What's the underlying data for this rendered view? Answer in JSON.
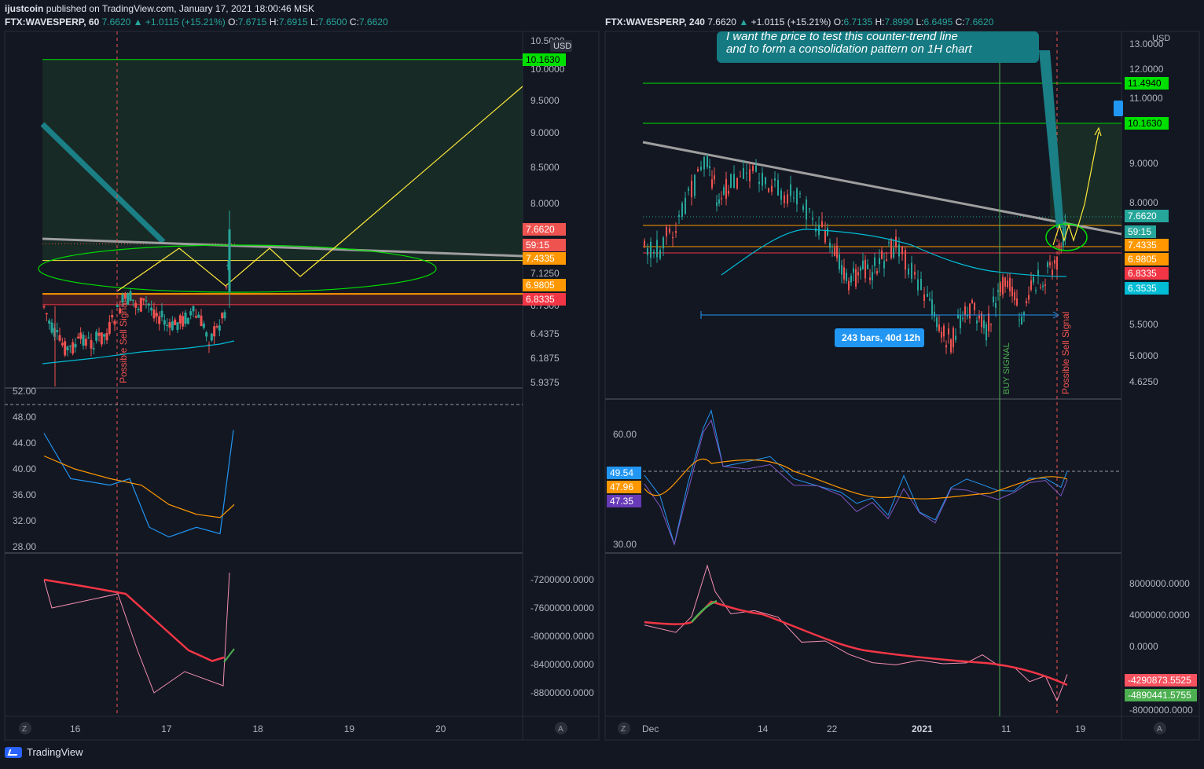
{
  "header": {
    "author": "ijustcoin",
    "published": "published on TradingView.com, January 17, 2021 18:00:46 MSK"
  },
  "left_symbol": {
    "name": "FTX:WAVESPERP, 60",
    "last": "7.6620",
    "change": "+1.0115 (+15.21%)",
    "o_label": "O:",
    "o": "7.6715",
    "h_label": "H:",
    "h": "7.6915",
    "l_label": "L:",
    "l": "7.6500",
    "c_label": "C:",
    "c": "7.6620"
  },
  "right_symbol": {
    "name": "FTX:WAVESPERP, 240",
    "last": "7.6620",
    "change": "+1.0115 (+15.21%)",
    "o_label": "O:",
    "o": "6.7135",
    "h_label": "H:",
    "h": "7.8990",
    "l_label": "L:",
    "l": "6.6495",
    "c_label": "C:",
    "c": "7.6620"
  },
  "chart_data": [
    {
      "type": "candlestick",
      "title": "FTX:WAVESPERP, 60",
      "currency": "USD",
      "price_axis_ticks": [
        "10.5000",
        "10.0000",
        "9.5000",
        "9.0000",
        "8.5000",
        "8.0000",
        "7.1250",
        "6.7500",
        "6.4375",
        "6.1875",
        "5.9375"
      ],
      "price_tags": [
        {
          "label": "10.1630",
          "color": "#00e000"
        },
        {
          "label": "7.6620",
          "color": "#ef5350"
        },
        {
          "label": "59:15",
          "color": "#ef5350"
        },
        {
          "label": "7.4335",
          "color": "#ff9800"
        },
        {
          "label": "6.9805",
          "color": "#ff9800"
        },
        {
          "label": "6.8335",
          "color": "#f23645"
        }
      ],
      "annotations": [
        "Possible Sell Signal"
      ],
      "time_axis": [
        "16",
        "17",
        "18",
        "19",
        "20"
      ],
      "close_series": [
        {
          "t": "15 12:00",
          "v": 6.75
        },
        {
          "t": "15 18:00",
          "v": 6.42
        },
        {
          "t": "16 00:00",
          "v": 6.35
        },
        {
          "t": "16 06:00",
          "v": 6.55
        },
        {
          "t": "16 12:00",
          "v": 6.95
        },
        {
          "t": "16 18:00",
          "v": 6.7
        },
        {
          "t": "17 00:00",
          "v": 6.6
        },
        {
          "t": "17 06:00",
          "v": 6.45
        },
        {
          "t": "17 12:00",
          "v": 6.75
        },
        {
          "t": "17 18:00",
          "v": 7.66
        }
      ],
      "rsi": {
        "ticks": [
          "52.00",
          "48.00",
          "44.00",
          "40.00",
          "36.00",
          "32.00",
          "28.00"
        ],
        "rsi_values": [
          45.5,
          38.5,
          37.5,
          38.5,
          31,
          29.5,
          31,
          30,
          46
        ],
        "ma_values": [
          42,
          40,
          38.5,
          37.5,
          34.5,
          33,
          32.5,
          34.5
        ]
      },
      "obv": {
        "ticks": [
          "-7200000.0000",
          "-7600000.0000",
          "-8000000.0000",
          "-8400000.0000",
          "-8800000.0000"
        ],
        "obv_values": [
          -7200000,
          -7600000,
          -7400000,
          -8200000,
          -8800000,
          -8500000,
          -8700000,
          -7100000
        ],
        "ma_values": [
          -7200000,
          -7300000,
          -7400000,
          -7900000,
          -8200000,
          -8350000,
          -8300000
        ]
      }
    },
    {
      "type": "candlestick",
      "title": "FTX:WAVESPERP, 240",
      "currency": "USD",
      "price_axis_ticks": [
        "13.0000",
        "12.0000",
        "11.0000",
        "9.0000",
        "8.0000",
        "5.5000",
        "5.0000",
        "4.6250"
      ],
      "price_tags": [
        {
          "label": "11.4940",
          "color": "#00e000"
        },
        {
          "label": "10.1630",
          "color": "#00e000"
        },
        {
          "label": "7.6620",
          "color": "#26a69a"
        },
        {
          "label": "59:15",
          "color": "#26a69a"
        },
        {
          "label": "7.4335",
          "color": "#ff9800"
        },
        {
          "label": "6.9805",
          "color": "#ff9800"
        },
        {
          "label": "6.8335",
          "color": "#f23645"
        },
        {
          "label": "6.3535",
          "color": "#00bcd4"
        }
      ],
      "annotations": [
        "I want the price to test this counter-trend line",
        "and to form a consolidation pattern on 1H chart",
        "243 bars, 40d 12h",
        "BUY SIGNAL",
        "Possible Sell Signal"
      ],
      "time_axis": [
        "Dec",
        "14",
        "22",
        "2021",
        "11",
        "19"
      ],
      "close_series": [
        {
          "t": "Dec 1",
          "v": 6.8
        },
        {
          "t": "Dec 5",
          "v": 7.8
        },
        {
          "t": "Dec 9",
          "v": 9.1
        },
        {
          "t": "Dec 13",
          "v": 8.7
        },
        {
          "t": "Dec 17",
          "v": 8.4
        },
        {
          "t": "Dec 21",
          "v": 7.3
        },
        {
          "t": "Dec 25",
          "v": 6.3
        },
        {
          "t": "Dec 29",
          "v": 6.8
        },
        {
          "t": "Jan 2",
          "v": 5.6
        },
        {
          "t": "Jan 6",
          "v": 5.3
        },
        {
          "t": "Jan 10",
          "v": 6.0
        },
        {
          "t": "Jan 14",
          "v": 6.4
        },
        {
          "t": "Jan 17",
          "v": 7.66
        }
      ],
      "rsi": {
        "ticks": [
          "60.00",
          "30.00"
        ],
        "labels": [
          {
            "label": "49.54",
            "color": "#2196f3"
          },
          {
            "label": "47.96",
            "color": "#ff9800"
          },
          {
            "label": "47.35",
            "color": "#673ab7"
          }
        ]
      },
      "obv": {
        "ticks": [
          "8000000.0000",
          "4000000.0000",
          "0.0000",
          "-8000000.0000"
        ],
        "labels": [
          {
            "label": "-4290873.5525",
            "color": "#f7525f"
          },
          {
            "label": "-4890441.5755",
            "color": "#4caf50"
          }
        ]
      }
    }
  ],
  "footer": {
    "brand": "TradingView",
    "z_button": "Z",
    "a_button": "A"
  }
}
